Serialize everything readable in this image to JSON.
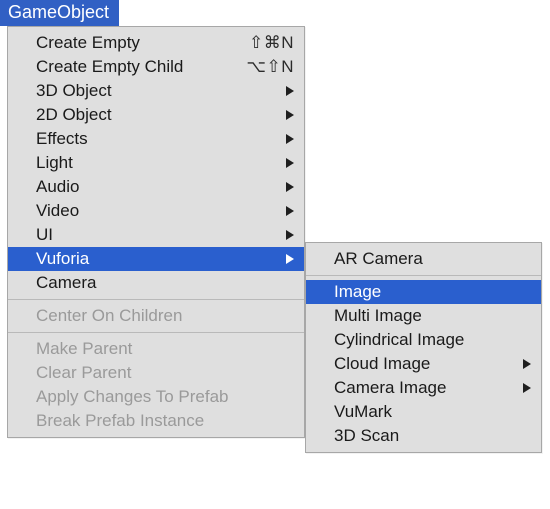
{
  "menuTitle": "GameObject",
  "mainMenu": {
    "items": [
      {
        "label": "Create Empty",
        "shortcut": "⇧⌘N",
        "hasSubmenu": false,
        "enabled": true,
        "selected": false
      },
      {
        "label": "Create Empty Child",
        "shortcut": "⌥⇧N",
        "hasSubmenu": false,
        "enabled": true,
        "selected": false
      },
      {
        "label": "3D Object",
        "shortcut": "",
        "hasSubmenu": true,
        "enabled": true,
        "selected": false
      },
      {
        "label": "2D Object",
        "shortcut": "",
        "hasSubmenu": true,
        "enabled": true,
        "selected": false
      },
      {
        "label": "Effects",
        "shortcut": "",
        "hasSubmenu": true,
        "enabled": true,
        "selected": false
      },
      {
        "label": "Light",
        "shortcut": "",
        "hasSubmenu": true,
        "enabled": true,
        "selected": false
      },
      {
        "label": "Audio",
        "shortcut": "",
        "hasSubmenu": true,
        "enabled": true,
        "selected": false
      },
      {
        "label": "Video",
        "shortcut": "",
        "hasSubmenu": true,
        "enabled": true,
        "selected": false
      },
      {
        "label": "UI",
        "shortcut": "",
        "hasSubmenu": true,
        "enabled": true,
        "selected": false
      },
      {
        "label": "Vuforia",
        "shortcut": "",
        "hasSubmenu": true,
        "enabled": true,
        "selected": true
      },
      {
        "label": "Camera",
        "shortcut": "",
        "hasSubmenu": false,
        "enabled": true,
        "selected": false
      },
      {
        "type": "divider"
      },
      {
        "label": "Center On Children",
        "shortcut": "",
        "hasSubmenu": false,
        "enabled": false,
        "selected": false
      },
      {
        "type": "divider"
      },
      {
        "label": "Make Parent",
        "shortcut": "",
        "hasSubmenu": false,
        "enabled": false,
        "selected": false
      },
      {
        "label": "Clear Parent",
        "shortcut": "",
        "hasSubmenu": false,
        "enabled": false,
        "selected": false
      },
      {
        "label": "Apply Changes To Prefab",
        "shortcut": "",
        "hasSubmenu": false,
        "enabled": false,
        "selected": false
      },
      {
        "label": "Break Prefab Instance",
        "shortcut": "",
        "hasSubmenu": false,
        "enabled": false,
        "selected": false
      }
    ]
  },
  "subMenu": {
    "items": [
      {
        "label": "AR Camera",
        "shortcut": "",
        "hasSubmenu": false,
        "enabled": true,
        "selected": false
      },
      {
        "type": "divider"
      },
      {
        "label": "Image",
        "shortcut": "",
        "hasSubmenu": false,
        "enabled": true,
        "selected": true
      },
      {
        "label": "Multi Image",
        "shortcut": "",
        "hasSubmenu": false,
        "enabled": true,
        "selected": false
      },
      {
        "label": "Cylindrical Image",
        "shortcut": "",
        "hasSubmenu": false,
        "enabled": true,
        "selected": false
      },
      {
        "label": "Cloud Image",
        "shortcut": "",
        "hasSubmenu": true,
        "enabled": true,
        "selected": false
      },
      {
        "label": "Camera Image",
        "shortcut": "",
        "hasSubmenu": true,
        "enabled": true,
        "selected": false
      },
      {
        "label": "VuMark",
        "shortcut": "",
        "hasSubmenu": false,
        "enabled": true,
        "selected": false
      },
      {
        "label": "3D Scan",
        "shortcut": "",
        "hasSubmenu": false,
        "enabled": true,
        "selected": false
      }
    ]
  }
}
